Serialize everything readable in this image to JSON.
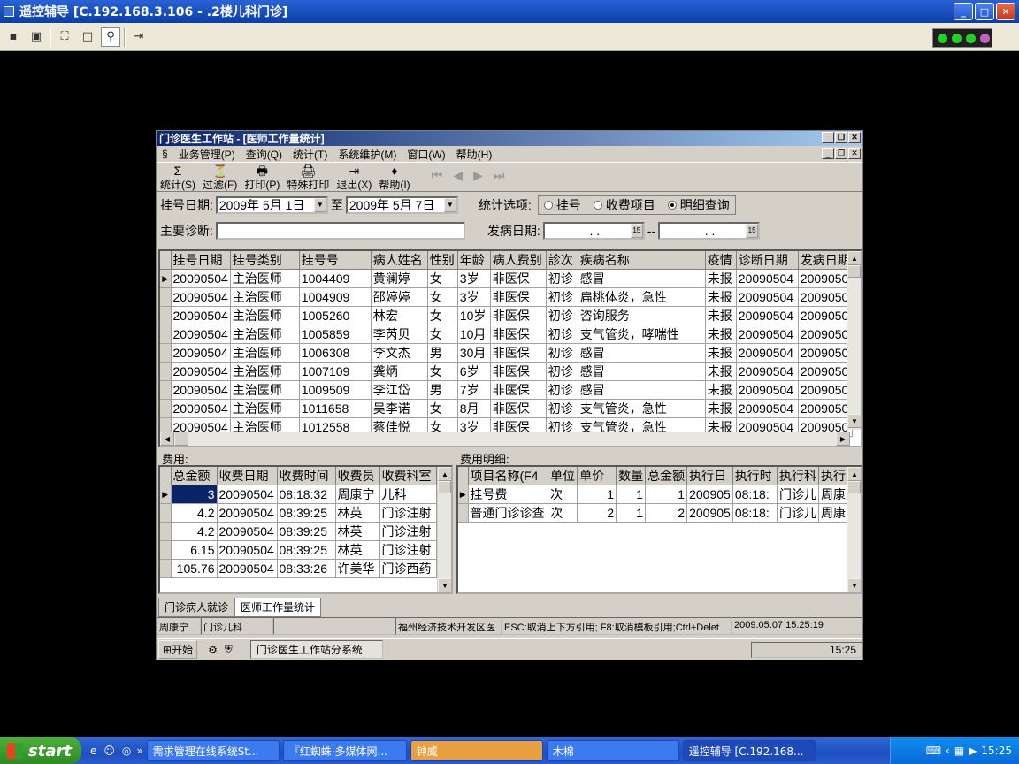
{
  "remote": {
    "title": "遥控辅导 [C.192.168.3.106 - .2楼儿科门诊]",
    "min": "_",
    "max": "□",
    "close": "✕"
  },
  "rc_toolbar": {
    "icons": [
      "save-icon",
      "screen-icon",
      "fit-icon",
      "window-icon",
      "zoom-icon",
      "exit-icon"
    ]
  },
  "app": {
    "title": "门诊医生工作站 - [医师工作量统计]",
    "menu": [
      "业务管理(P)",
      "查询(Q)",
      "统计(T)",
      "系统维护(M)",
      "窗口(W)",
      "帮助(H)"
    ],
    "toolbar": [
      {
        "icon": "Σ",
        "label": "统计(S)"
      },
      {
        "icon": "⏳",
        "label": "过滤(F)"
      },
      {
        "icon": "🖶",
        "label": "打印(P)"
      },
      {
        "icon": "🖨",
        "label": "特殊打印"
      },
      {
        "icon": "⇥",
        "label": "退出(X)"
      },
      {
        "icon": "♦",
        "label": "帮助(I)"
      }
    ],
    "nav": [
      "⏮",
      "◀",
      "▶",
      "⏭"
    ],
    "filter": {
      "reg_date_label": "挂号日期:",
      "date_from": "2009年 5月 1日",
      "to": "至",
      "date_to": "2009年 5月 7日",
      "stat_label": "统计选项:",
      "opt1": "挂号",
      "opt2": "收费项目",
      "opt3": "明细查询",
      "diag_label": "主要诊断:",
      "onset_label": "发病日期:",
      "onset_from": ".  .",
      "dash": "--",
      "onset_to": ".  ."
    },
    "main_table": {
      "headers": [
        "挂号日期",
        "挂号类别",
        "挂号号",
        "病人姓名",
        "性别",
        "年龄",
        "病人费别",
        "診次",
        "疾病名称",
        "疫情",
        "诊断日期",
        "发病日期"
      ],
      "rows": [
        [
          "20090504",
          "主治医师",
          "1004409",
          "黄澜婷",
          "女",
          "3岁",
          "非医保",
          "初诊",
          "感冒",
          "未报",
          "20090504",
          "2009050"
        ],
        [
          "20090504",
          "主治医师",
          "1004909",
          "邵婷婷",
          "女",
          "3岁",
          "非医保",
          "初诊",
          "扁桃体炎，急性",
          "未报",
          "20090504",
          "2009050"
        ],
        [
          "20090504",
          "主治医师",
          "1005260",
          "林宏",
          "女",
          "10岁",
          "非医保",
          "初诊",
          "咨询服务",
          "未报",
          "20090504",
          "2009050"
        ],
        [
          "20090504",
          "主治医师",
          "1005859",
          "李芮贝",
          "女",
          "10月",
          "非医保",
          "初诊",
          "支气管炎，哮喘性",
          "未报",
          "20090504",
          "2009050"
        ],
        [
          "20090504",
          "主治医师",
          "1006308",
          "李文杰",
          "男",
          "30月",
          "非医保",
          "初诊",
          "感冒",
          "未报",
          "20090504",
          "2009050"
        ],
        [
          "20090504",
          "主治医师",
          "1007109",
          "龚炳",
          "女",
          "6岁",
          "非医保",
          "初诊",
          "感冒",
          "未报",
          "20090504",
          "2009050"
        ],
        [
          "20090504",
          "主治医师",
          "1009509",
          "李江岱",
          "男",
          "7岁",
          "非医保",
          "初诊",
          "感冒",
          "未报",
          "20090504",
          "2009050"
        ],
        [
          "20090504",
          "主治医师",
          "1011658",
          "吴李诺",
          "女",
          "8月",
          "非医保",
          "初诊",
          "支气管炎，急性",
          "未报",
          "20090504",
          "2009050"
        ],
        [
          "20090504",
          "主治医师",
          "1012558",
          "蔡佳悦",
          "女",
          "3岁",
          "非医保",
          "初诊",
          "支气管炎，急性",
          "未报",
          "20090504",
          "2009050"
        ]
      ]
    },
    "fee_label": "费用:",
    "fee_table": {
      "headers": [
        "总金额",
        "收费日期",
        "收费时间",
        "收费员",
        "收费科室"
      ],
      "rows": [
        [
          "3",
          "20090504",
          "08:18:32",
          "周康宁",
          "儿科"
        ],
        [
          "4.2",
          "20090504",
          "08:39:25",
          "林英",
          "门诊注射"
        ],
        [
          "4.2",
          "20090504",
          "08:39:25",
          "林英",
          "门诊注射"
        ],
        [
          "6.15",
          "20090504",
          "08:39:25",
          "林英",
          "门诊注射"
        ],
        [
          "105.76",
          "20090504",
          "08:33:26",
          "许美华",
          "门诊西药"
        ]
      ]
    },
    "detail_label": "费用明细:",
    "detail_table": {
      "headers": [
        "项目名称(F4",
        "单位",
        "单价",
        "数量",
        "总金额",
        "执行日",
        "执行时",
        "执行科",
        "执行医"
      ],
      "rows": [
        [
          "挂号费",
          "次",
          "1",
          "1",
          "1",
          "200905",
          "08:18:",
          "门诊儿",
          "周康宁"
        ],
        [
          "普通门诊诊查",
          "次",
          "2",
          "1",
          "2",
          "200905",
          "08:18:",
          "门诊儿",
          "周康宁"
        ]
      ]
    },
    "tabs": [
      "门诊病人就诊",
      "医师工作量统计"
    ],
    "status": [
      "周康宁",
      "门诊儿科",
      "",
      "福州经济技术开发区医",
      "ESC:取消上下方引用; F8:取消模板引用;Ctrl+Delet",
      "2009.05.07 15:25:19"
    ],
    "inner_taskbar": {
      "start": "开始",
      "task": "门诊医生工作站分系统",
      "time": "15:25"
    }
  },
  "taskbar": {
    "start": "start",
    "items": [
      "需求管理在线系统St...",
      "『红蜘蛛·多媒体网...",
      "钟威",
      "木棉",
      "遥控辅导 [C.192.168..."
    ],
    "time": "15:25"
  }
}
